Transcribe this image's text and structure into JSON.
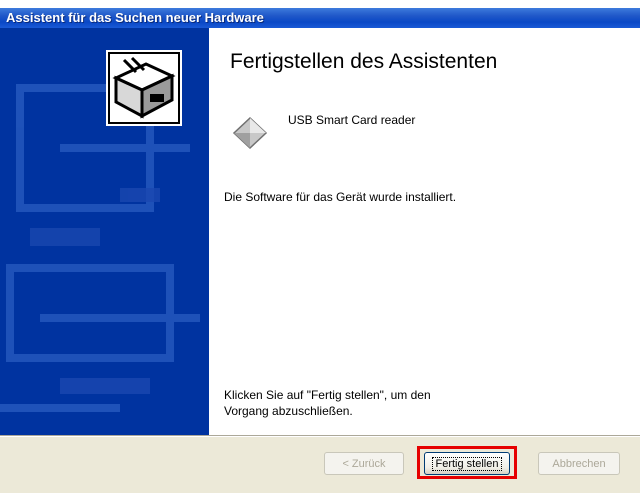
{
  "window": {
    "title": "Assistent für das Suchen neuer Hardware"
  },
  "banner": {
    "icon": "hardware-wizard-icon",
    "background_color": "#0033a0"
  },
  "content": {
    "heading": "Fertigstellen des Assistenten",
    "device_icon": "device-diamond-icon",
    "device_name": "USB Smart Card reader",
    "installed_text": "Die Software für das Gerät wurde installiert.",
    "hint_line1": "Klicken Sie auf \"Fertig stellen\", um den",
    "hint_line2": "Vorgang abzuschließen."
  },
  "buttons": {
    "back_label": "< Zurück",
    "finish_label": "Fertig stellen",
    "cancel_label": "Abbrechen"
  },
  "colors": {
    "title_bar": "#0a48c6",
    "highlight": "#e60000"
  }
}
